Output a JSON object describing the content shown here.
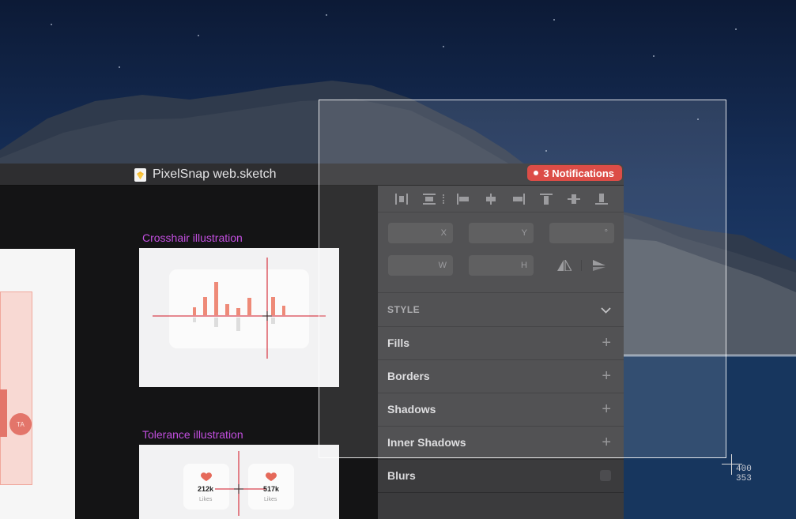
{
  "window": {
    "title": "PixelSnap web.sketch",
    "notifications": "3 Notifications"
  },
  "canvas": {
    "artboard_1_label": "Crosshair illustration",
    "artboard_2_label": "Tolerance illustration",
    "left_badge": "TA",
    "tolerance_cards": [
      {
        "value": "212k",
        "label": "Likes"
      },
      {
        "value": "517k",
        "label": "Likes"
      }
    ]
  },
  "inspector": {
    "fields": {
      "x": "X",
      "y": "Y",
      "rotation": "°",
      "w": "W",
      "h": "H"
    },
    "style_header": "STYLE",
    "sections": [
      "Fills",
      "Borders",
      "Shadows",
      "Inner Shadows",
      "Blurs"
    ]
  },
  "measurement": {
    "width": "400",
    "height": "353"
  },
  "colors": {
    "artboard_label": "#c34fe0",
    "notification_badge": "#d8352e",
    "chart_bars": "#ee8a78",
    "crosshair": "#d9434f"
  },
  "icons": {
    "align": [
      "distribute-horizontal-icon",
      "distribute-vertical-icon",
      "align-left-icon",
      "align-center-horizontal-icon",
      "align-right-icon",
      "align-top-icon",
      "align-middle-icon",
      "align-bottom-icon"
    ],
    "flip": [
      "flip-horizontal-icon",
      "flip-vertical-icon"
    ]
  }
}
